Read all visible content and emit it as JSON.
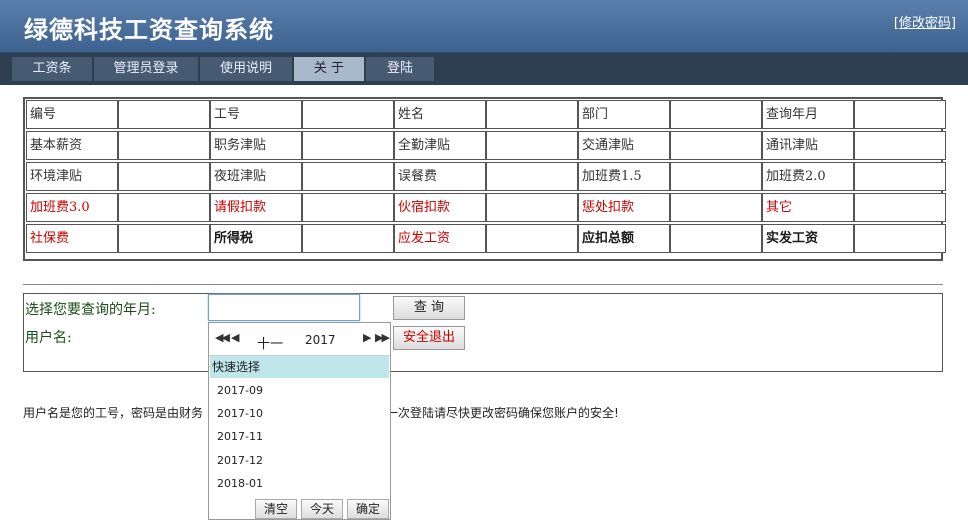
{
  "header": {
    "title": "绿德科技工资查询系统",
    "modify_link": "[修改密码]"
  },
  "nav": {
    "tabs": [
      {
        "label": "工资条"
      },
      {
        "label": "管理员登录"
      },
      {
        "label": "使用说明"
      },
      {
        "label": "关 于",
        "active": true
      },
      {
        "label": "登陆"
      }
    ]
  },
  "salary_table": {
    "rows": [
      [
        "编号",
        "工号",
        "姓名",
        "部门",
        "查询年月"
      ],
      [
        "基本薪资",
        "职务津贴",
        "全勤津贴",
        "交通津贴",
        "通讯津贴"
      ],
      [
        "环境津贴",
        "夜班津贴",
        "误餐费",
        "加班费1.5",
        "加班费2.0"
      ],
      [
        "加班费3.0",
        "请假扣款",
        "伙宿扣款",
        "惩处扣款",
        "其它"
      ],
      [
        "社保费",
        "所得税",
        "应发工资",
        "应扣总额",
        "实发工资"
      ]
    ]
  },
  "query": {
    "month_label": "选择您要查询的年月:",
    "user_label": "用户名:",
    "month_value": "",
    "query_button": "查 询",
    "logout_button": "安全退出"
  },
  "note": "用户名是您的工号，密码是由财务",
  "note_tail": "一次登陆请尽快更改密码确保您账户的安全!",
  "picker": {
    "prev_year": "◀◀",
    "prev_month": "◀",
    "month": "十一",
    "year": "2017",
    "next_month": "▶",
    "next_year": "▶▶",
    "quick_label": "快速选择",
    "options": [
      "2017-09",
      "2017-10",
      "2017-11",
      "2017-12",
      "2018-01"
    ],
    "clear": "清空",
    "today": "今天",
    "ok": "确定"
  },
  "colors": {
    "header": "#4a6d9a",
    "nav": "#2f3f52",
    "warn": "#cc0000"
  }
}
